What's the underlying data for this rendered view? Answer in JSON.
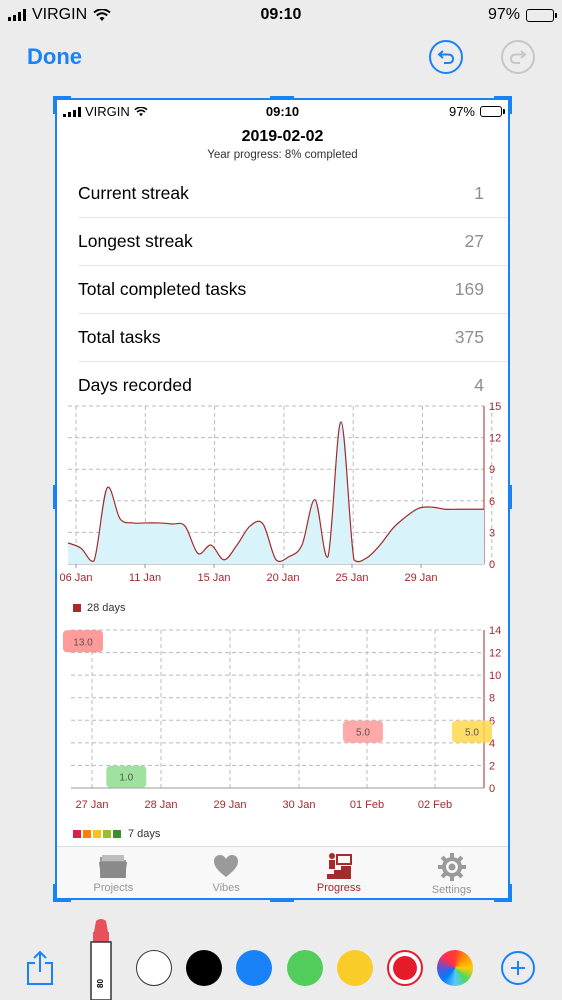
{
  "status_bar": {
    "carrier": "VIRGIN",
    "time": "09:10",
    "battery": "97%"
  },
  "toolbar": {
    "done_label": "Done"
  },
  "screenshot": {
    "status_bar": {
      "carrier": "VIRGIN",
      "time": "09:10",
      "battery": "97%"
    },
    "date": "2019-02-02",
    "progress": "Year progress: 8% completed",
    "stats": [
      {
        "label": "Current streak",
        "value": "1"
      },
      {
        "label": "Longest streak",
        "value": "27"
      },
      {
        "label": "Total completed tasks",
        "value": "169"
      },
      {
        "label": "Total tasks",
        "value": "375"
      },
      {
        "label": "Days recorded",
        "value": "4"
      }
    ],
    "legend1": "28 days",
    "legend2": "7 days",
    "legend2_colors": [
      "#d9224a",
      "#ff7f00",
      "#f7c21a",
      "#9bbf2a",
      "#3a8e2f"
    ],
    "tabs": [
      {
        "label": "Projects",
        "icon": "folder-icon"
      },
      {
        "label": "Vibes",
        "icon": "heart-icon"
      },
      {
        "label": "Progress",
        "icon": "progress-icon"
      },
      {
        "label": "Settings",
        "icon": "gear-icon"
      }
    ]
  },
  "colors": {
    "accent": "#1a82f7",
    "chart_line": "#a52a2a",
    "chart_fill": "#d9f3fb"
  },
  "chart_data": [
    {
      "type": "area",
      "x_tick_labels": [
        "06 Jan",
        "11 Jan",
        "15 Jan",
        "20 Jan",
        "25 Jan",
        "29 Jan"
      ],
      "y_ticks": [
        "0",
        "3",
        "6",
        "9",
        "12",
        "15"
      ],
      "ylim": [
        0,
        15
      ],
      "x_days": [
        0,
        1,
        2,
        3,
        4,
        5,
        6,
        7,
        8,
        9,
        10,
        11,
        12,
        13,
        14,
        15,
        16,
        17,
        18,
        19,
        20,
        21,
        22,
        23,
        24,
        25,
        26,
        27,
        28,
        29,
        30,
        31,
        32
      ],
      "values": [
        2.0,
        1.5,
        0.3,
        7.2,
        4.3,
        3.9,
        3.9,
        3.9,
        3.8,
        3.6,
        1.0,
        1.8,
        0.4,
        1.8,
        3.6,
        3.8,
        0.4,
        0.7,
        1.8,
        6.1,
        0.7,
        13.5,
        0.4,
        0.6,
        1.8,
        3.4,
        4.5,
        5.3,
        5.4,
        5.2,
        5.2,
        5.2,
        5.2
      ],
      "series": [
        {
          "name": "28 days"
        }
      ],
      "legend": "bottom-left",
      "grid": true
    },
    {
      "type": "scatter",
      "x_tick_labels": [
        "27 Jan",
        "28 Jan",
        "29 Jan",
        "30 Jan",
        "01 Feb",
        "02 Feb"
      ],
      "y_ticks": [
        "0",
        "2",
        "4",
        "6",
        "8",
        "10",
        "12",
        "14"
      ],
      "ylim": [
        0,
        14
      ],
      "points": [
        {
          "x": -0.5,
          "y": 13.0,
          "label": "13.0",
          "color": "#ff8a8a"
        },
        {
          "x": 0.5,
          "y": 1.0,
          "label": "1.0",
          "color": "#8fdc8f"
        },
        {
          "x": 3.95,
          "y": 5.0,
          "label": "5.0",
          "color": "#ff9a9a"
        },
        {
          "x": 5.6,
          "y": 5.0,
          "label": "5.0",
          "color": "#ffd84a"
        }
      ],
      "series": [
        {
          "name": "7 days"
        }
      ],
      "legend": "bottom-left",
      "grid": true
    }
  ]
}
